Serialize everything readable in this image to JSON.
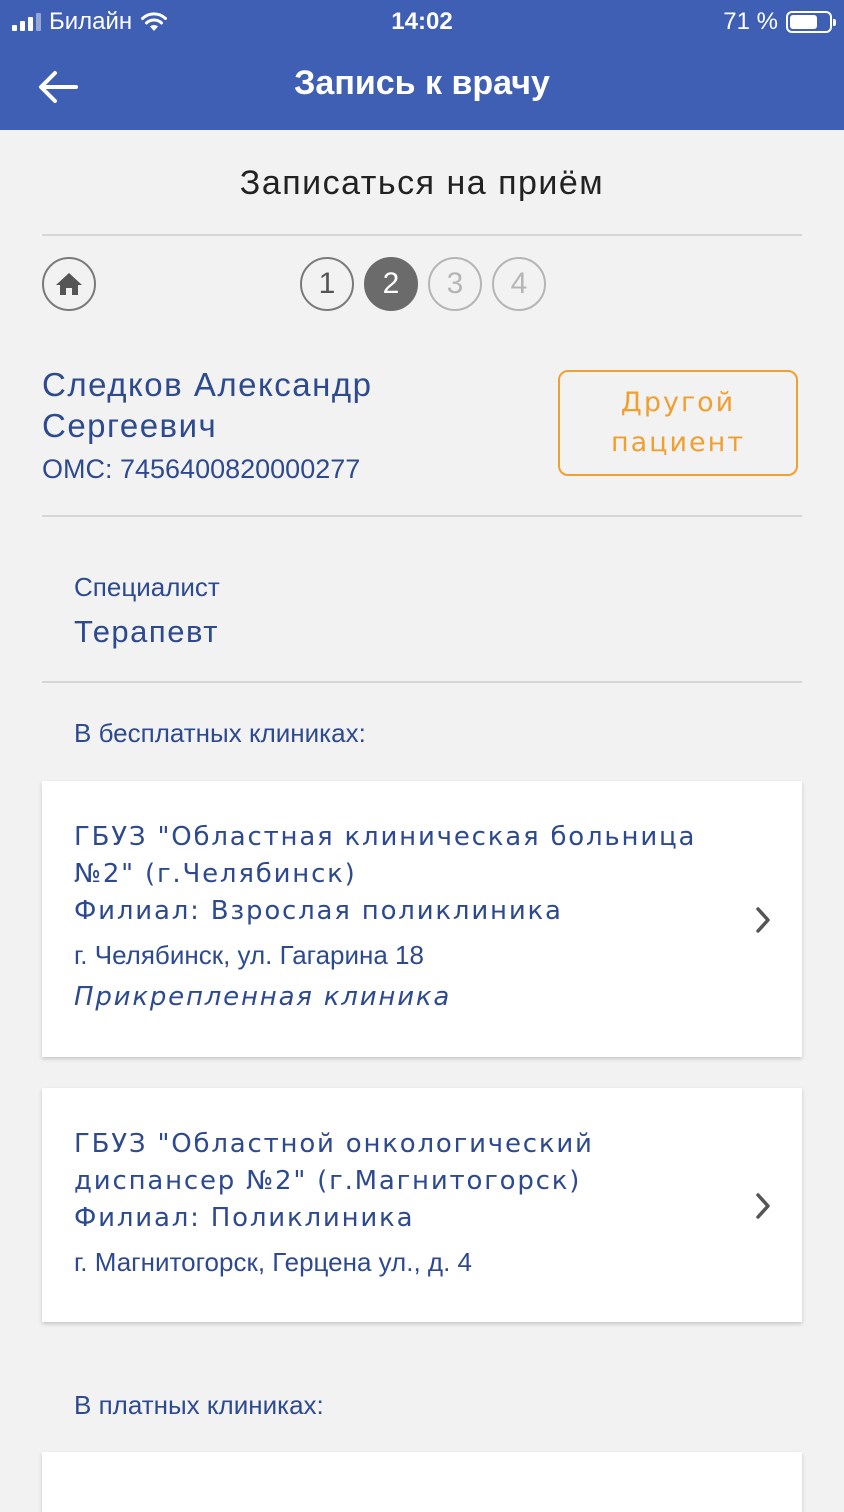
{
  "status_bar": {
    "carrier": "Билайн",
    "time": "14:02",
    "battery": "71 %",
    "battery_level": 0.71
  },
  "nav": {
    "title": "Запись к врачу",
    "back_icon": "arrow-left-icon"
  },
  "page": {
    "title": "Записаться на приём"
  },
  "steps": [
    "1",
    "2",
    "3",
    "4"
  ],
  "current_step": 2,
  "patient": {
    "name": "Следков Александр Сергеевич",
    "oms": "ОМС: 7456400820000277",
    "other_patient_label": "Другой пациент"
  },
  "specialist": {
    "label": "Специалист",
    "value": "Терапевт"
  },
  "free_clinics": {
    "label": "В бесплатных клиниках:",
    "items": [
      {
        "name": "ГБУЗ \"Областная клиническая больница №2\" (г.Челябинск)",
        "branch": "Филиал: Взрослая поликлиника",
        "address": "г. Челябинск, ул. Гагарина 18",
        "attached": "Прикрепленная клиника"
      },
      {
        "name": "ГБУЗ \"Областной онкологический диспансер №2\" (г.Магнитогорск)",
        "branch": "Филиал: Поликлиника",
        "address": "г. Магнитогорск, Герцена ул., д. 4"
      }
    ]
  },
  "paid_clinics": {
    "label": "В платных клиниках:"
  },
  "colors": {
    "header": "#3f5fb5",
    "text_primary": "#2e4a8f",
    "accent": "#f0a030"
  }
}
